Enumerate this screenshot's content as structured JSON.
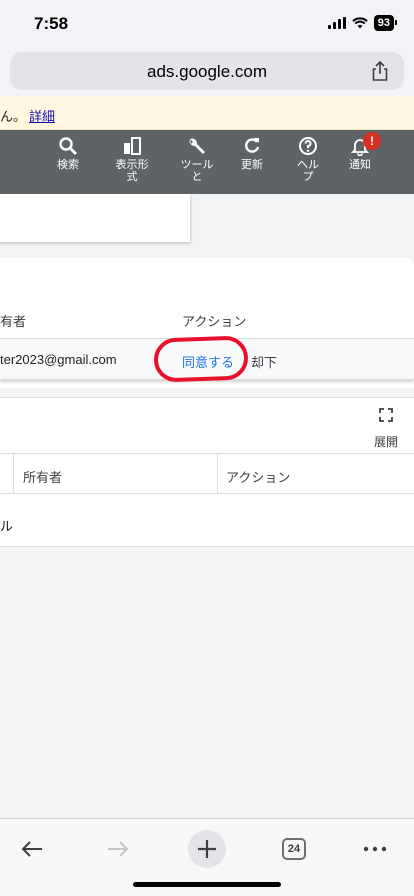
{
  "status": {
    "time": "7:58",
    "battery": "93"
  },
  "browser": {
    "url": "ads.google.com",
    "tab_count": "24"
  },
  "banner": {
    "text": "ん。",
    "link": "詳細"
  },
  "toolbar": {
    "items": [
      {
        "label": "検索",
        "icon": "search-icon"
      },
      {
        "label": "表示形式",
        "icon": "layout-icon"
      },
      {
        "label": "ツールと",
        "icon": "wrench-icon"
      },
      {
        "label": "更新",
        "icon": "refresh-icon"
      },
      {
        "label": "ヘルプ",
        "icon": "help-icon"
      },
      {
        "label": "通知",
        "icon": "bell-icon"
      }
    ],
    "notification_badge": "!"
  },
  "invitations": {
    "headers": {
      "owner": "有者",
      "action": "アクション"
    },
    "row": {
      "email": "ter2023@gmail.com",
      "accept": "同意する",
      "reject": "却下"
    }
  },
  "table2": {
    "expand_label": "展開",
    "headers": {
      "owner": "所有者",
      "action": "アクション"
    },
    "row_text": "ル"
  },
  "colors": {
    "toolbar_bg": "#5f6368",
    "link_blue": "#1a73e8",
    "badge_red": "#d93025",
    "annotation_red": "#e8102a"
  }
}
